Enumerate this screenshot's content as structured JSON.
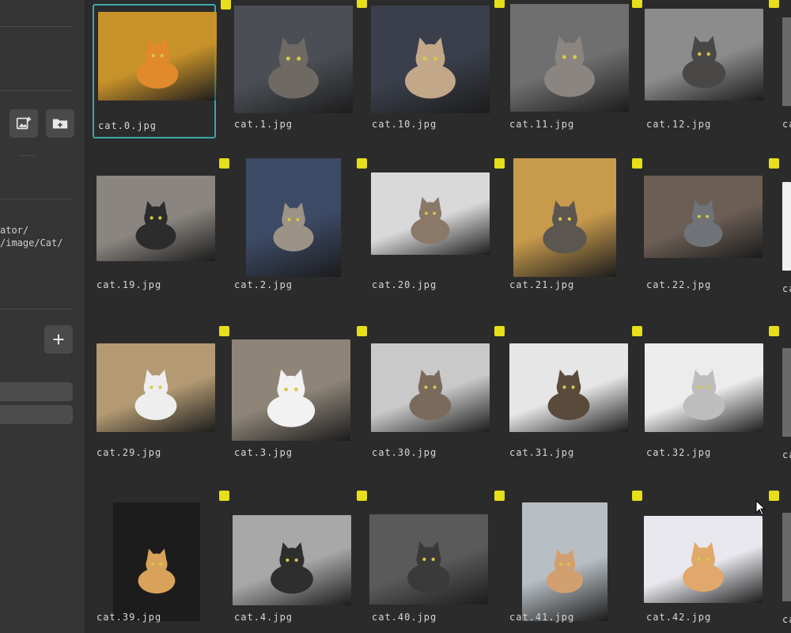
{
  "sidebar": {
    "path_lines": [
      "ator/",
      "/image/Cat/"
    ],
    "add_image_icon": "add-photo-icon",
    "add_folder_icon": "create-folder-icon",
    "add_icon": "plus-icon"
  },
  "gallery": {
    "selected_index": 0,
    "check_color": "#e6df19",
    "items": [
      {
        "name": "cat.0.jpg",
        "bg": "#c8922a",
        "fg": "#e08a2c",
        "row": 0,
        "col": 0
      },
      {
        "name": "cat.1.jpg",
        "bg": "#4b4f55",
        "fg": "#6e6a63",
        "row": 0,
        "col": 1
      },
      {
        "name": "cat.10.jpg",
        "bg": "#3a3f4b",
        "fg": "#c2a888",
        "row": 0,
        "col": 2
      },
      {
        "name": "cat.11.jpg",
        "bg": "#6f6f6f",
        "fg": "#8a8580",
        "row": 0,
        "col": 3
      },
      {
        "name": "cat.12.jpg",
        "bg": "#8c8c8c",
        "fg": "#4a4846",
        "row": 0,
        "col": 4
      },
      {
        "name": "cat.19.jpg",
        "bg": "#8a8580",
        "fg": "#2c2c2c",
        "row": 1,
        "col": 0
      },
      {
        "name": "cat.2.jpg",
        "bg": "#3d4a66",
        "fg": "#9b9385",
        "row": 1,
        "col": 1
      },
      {
        "name": "cat.20.jpg",
        "bg": "#d9d9d9",
        "fg": "#8a7868",
        "row": 1,
        "col": 2
      },
      {
        "name": "cat.21.jpg",
        "bg": "#c79a4c",
        "fg": "#5c5650",
        "row": 1,
        "col": 3
      },
      {
        "name": "cat.22.jpg",
        "bg": "#6b5e55",
        "fg": "#6f7378",
        "row": 1,
        "col": 4
      },
      {
        "name": "cat.29.jpg",
        "bg": "#b39a72",
        "fg": "#eeeeee",
        "row": 2,
        "col": 0
      },
      {
        "name": "cat.3.jpg",
        "bg": "#8e8578",
        "fg": "#f2f2f2",
        "row": 2,
        "col": 1
      },
      {
        "name": "cat.30.jpg",
        "bg": "#c9c9c9",
        "fg": "#7a6a5c",
        "row": 2,
        "col": 2
      },
      {
        "name": "cat.31.jpg",
        "bg": "#e6e6e6",
        "fg": "#5a4a3c",
        "row": 2,
        "col": 3
      },
      {
        "name": "cat.32.jpg",
        "bg": "#ececec",
        "fg": "#bdbdbd",
        "row": 2,
        "col": 4
      },
      {
        "name": "cat.39.jpg",
        "bg": "#1c1c1c",
        "fg": "#d9a25a",
        "row": 3,
        "col": 0
      },
      {
        "name": "cat.4.jpg",
        "bg": "#a8a8a8",
        "fg": "#2e2e2e",
        "row": 3,
        "col": 1
      },
      {
        "name": "cat.40.jpg",
        "bg": "#5a5a5a",
        "fg": "#3a3a3a",
        "row": 3,
        "col": 2
      },
      {
        "name": "cat.41.jpg",
        "bg": "#b8bfc4",
        "fg": "#d2a070",
        "row": 3,
        "col": 3
      },
      {
        "name": "cat.42.jpg",
        "bg": "#e8e8ee",
        "fg": "#e0a86a",
        "row": 3,
        "col": 4
      }
    ],
    "partial_labels": [
      "ca",
      "ca",
      "ca",
      "ca"
    ]
  }
}
